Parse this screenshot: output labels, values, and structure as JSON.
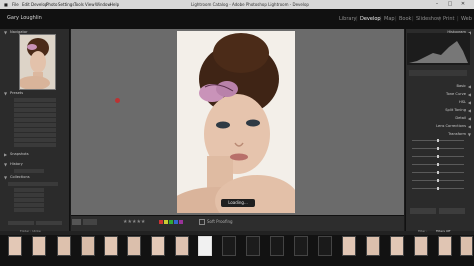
{
  "menubar": {
    "title": "Lightroom Catalog - Adobe Photoshop Lightroom - Develop",
    "items": [
      "File",
      "Edit",
      "Develop",
      "Photo",
      "Settings",
      "Tools",
      "View",
      "Window",
      "Help"
    ],
    "controls": [
      "–",
      "□",
      "✕"
    ]
  },
  "identity": {
    "user": "Gary Loughlin",
    "modules": [
      "Library",
      "Develop",
      "Map",
      "Book",
      "Slideshow",
      "Print",
      "Web"
    ],
    "active_module": "Develop"
  },
  "left_panel": {
    "navigator": "Navigator",
    "presets": "Presets",
    "snapshots": "Snapshots",
    "history": "History",
    "collections": "Collections"
  },
  "right_panel": {
    "histogram": "Histogram",
    "sections": [
      "Basic",
      "Tone Curve",
      "HSL",
      "Split Toning",
      "Detail",
      "Lens Corrections",
      "Transform"
    ]
  },
  "view": {
    "loading": "Loading..."
  },
  "toolbar": {
    "soft_proofing": "Soft Proofing"
  },
  "filmstrip": {
    "label": "Folder : Ulrike",
    "filter": "Filter :",
    "filters_off": "Filters Off"
  },
  "colors": {
    "accent": "#e6e6e6",
    "panel": "#2b2b2b",
    "view_bg": "#6b6b6b"
  }
}
